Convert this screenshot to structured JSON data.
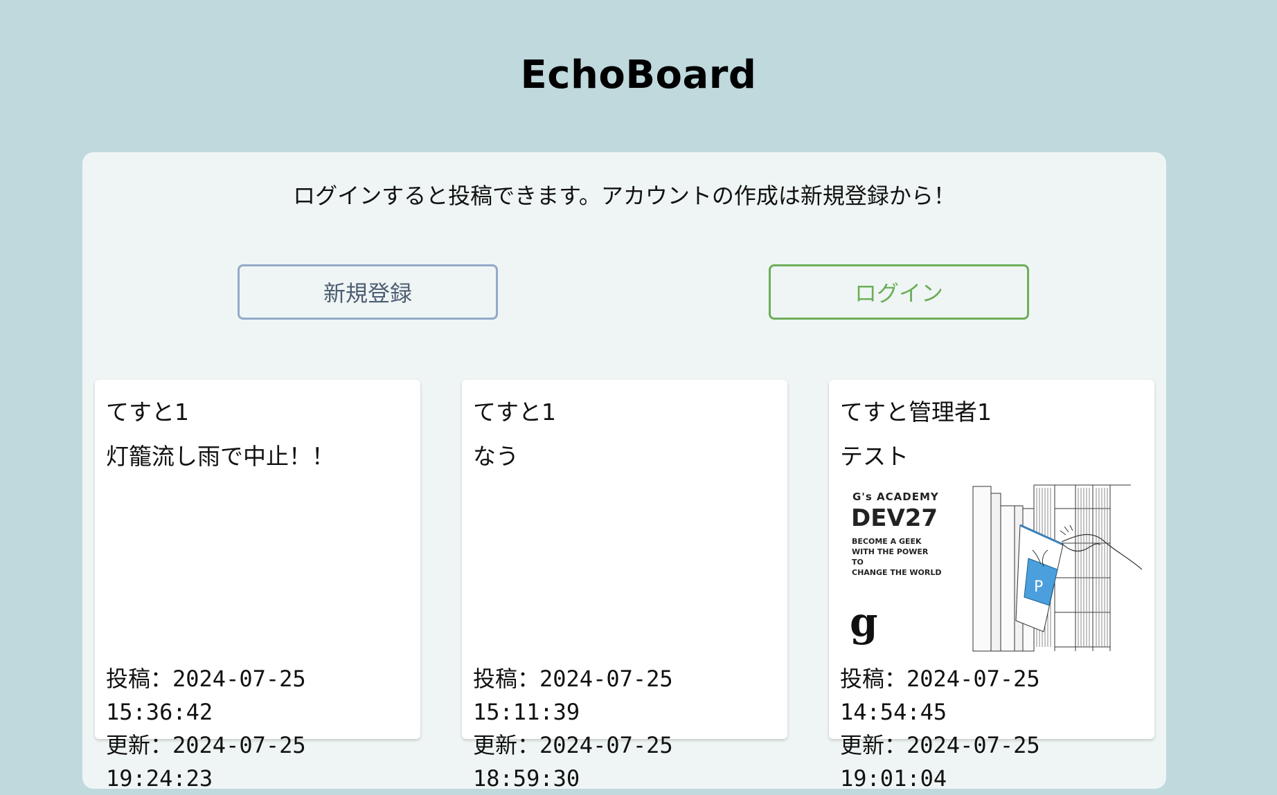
{
  "header": {
    "title": "EchoBoard"
  },
  "notice": "ログインすると投稿できます。アカウントの作成は新規登録から！",
  "buttons": {
    "register": "新規登録",
    "login": "ログイン"
  },
  "posts": [
    {
      "author": "てすと1",
      "body": "灯籠流し雨で中止！！",
      "posted": "投稿：2024-07-25 15:36:42",
      "updated": "更新：2024-07-25 19:24:23"
    },
    {
      "author": "てすと1",
      "body": "なう",
      "posted": "投稿：2024-07-25 15:11:39",
      "updated": "更新：2024-07-25 18:59:30"
    },
    {
      "author": "てすと管理者1",
      "body": "テスト",
      "posted": "投稿：2024-07-25 14:54:45",
      "updated": "更新：2024-07-25 19:01:04",
      "image": {
        "brand": "G's ACADEMY",
        "title": "DEV27",
        "tagline": [
          "BECOME A GEEK",
          "WITH THE POWER TO",
          "CHANGE THE WORLD"
        ],
        "logo": "g"
      }
    }
  ],
  "colors": {
    "background": "#bfd9dd",
    "panel": "#eff5f4",
    "register_border": "#92aacb",
    "login_border": "#6cae5a"
  }
}
